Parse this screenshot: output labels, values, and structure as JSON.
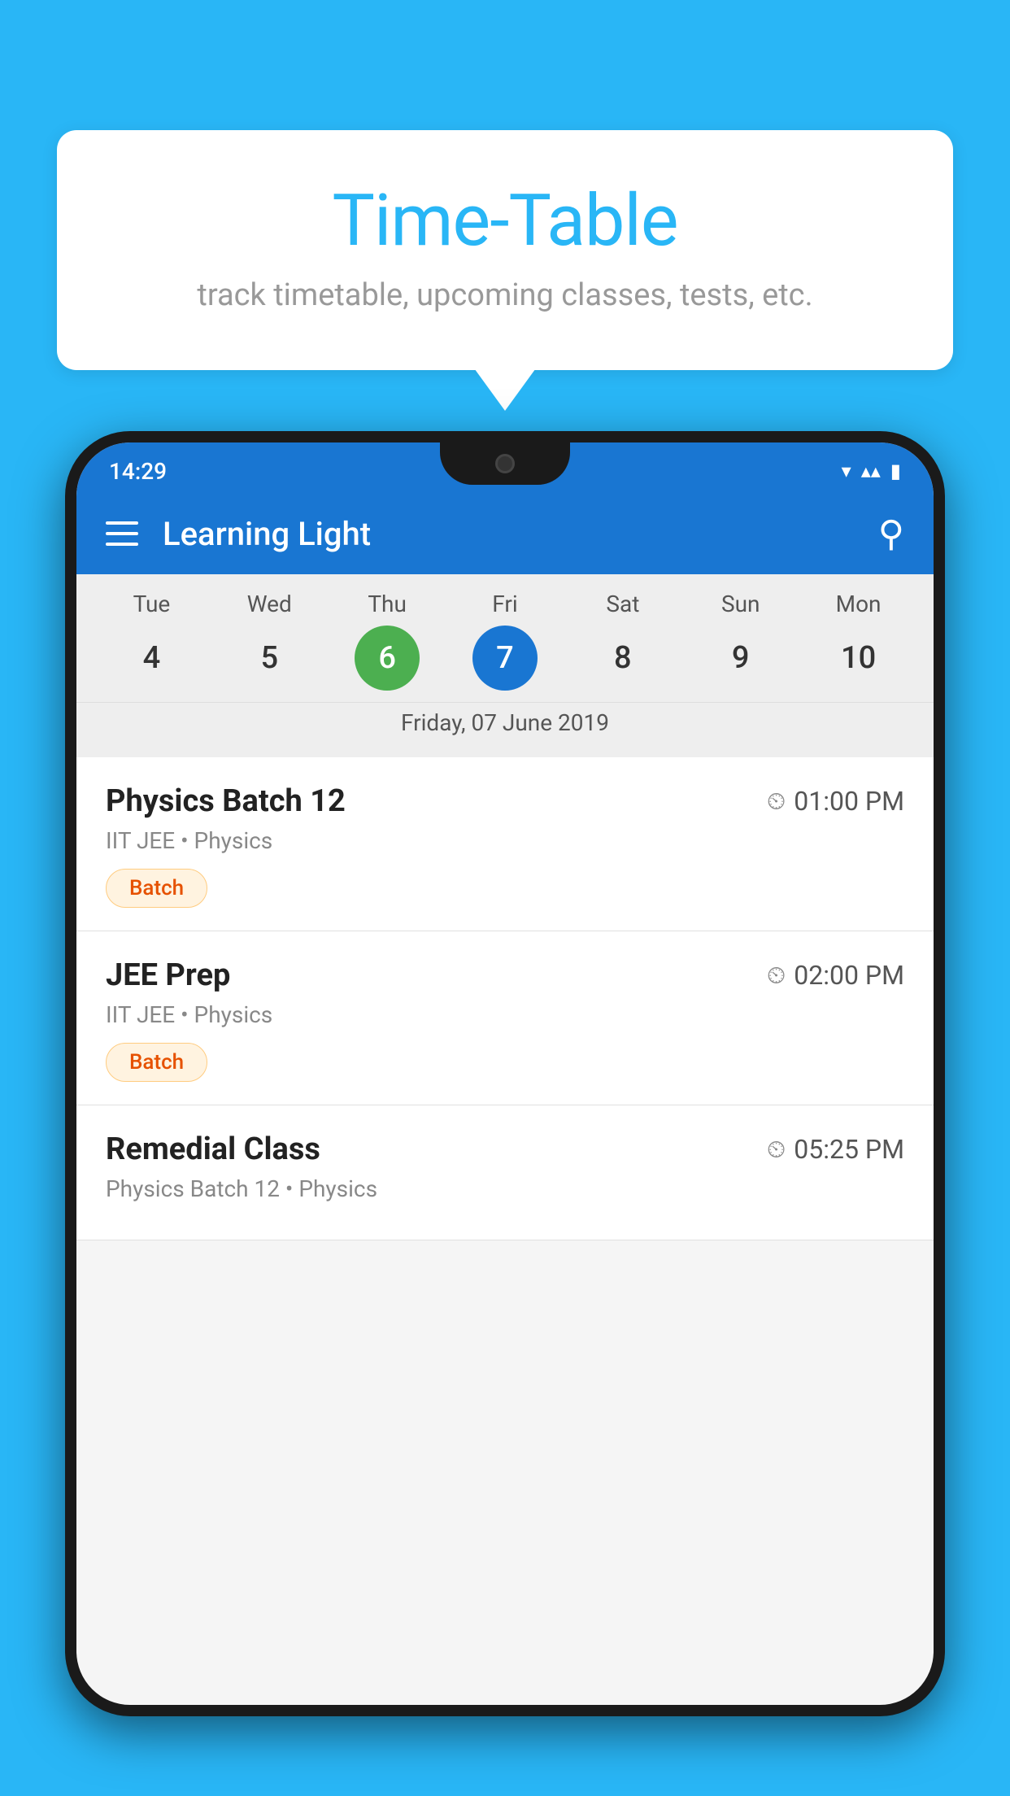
{
  "background": {
    "color": "#29b6f6"
  },
  "speechBubble": {
    "title": "Time-Table",
    "subtitle": "track timetable, upcoming classes, tests, etc."
  },
  "phone": {
    "statusBar": {
      "time": "14:29"
    },
    "appBar": {
      "title": "Learning Light"
    },
    "calendar": {
      "dayNames": [
        "Tue",
        "Wed",
        "Thu",
        "Fri",
        "Sat",
        "Sun",
        "Mon"
      ],
      "dayNumbers": [
        "4",
        "5",
        "6",
        "7",
        "8",
        "9",
        "10"
      ],
      "todayIndex": 2,
      "selectedIndex": 3,
      "selectedDateLabel": "Friday, 07 June 2019"
    },
    "schedule": [
      {
        "title": "Physics Batch 12",
        "time": "01:00 PM",
        "sub": "IIT JEE • Physics",
        "badge": "Batch"
      },
      {
        "title": "JEE Prep",
        "time": "02:00 PM",
        "sub": "IIT JEE • Physics",
        "badge": "Batch"
      },
      {
        "title": "Remedial Class",
        "time": "05:25 PM",
        "sub": "Physics Batch 12 • Physics",
        "badge": null
      }
    ]
  }
}
